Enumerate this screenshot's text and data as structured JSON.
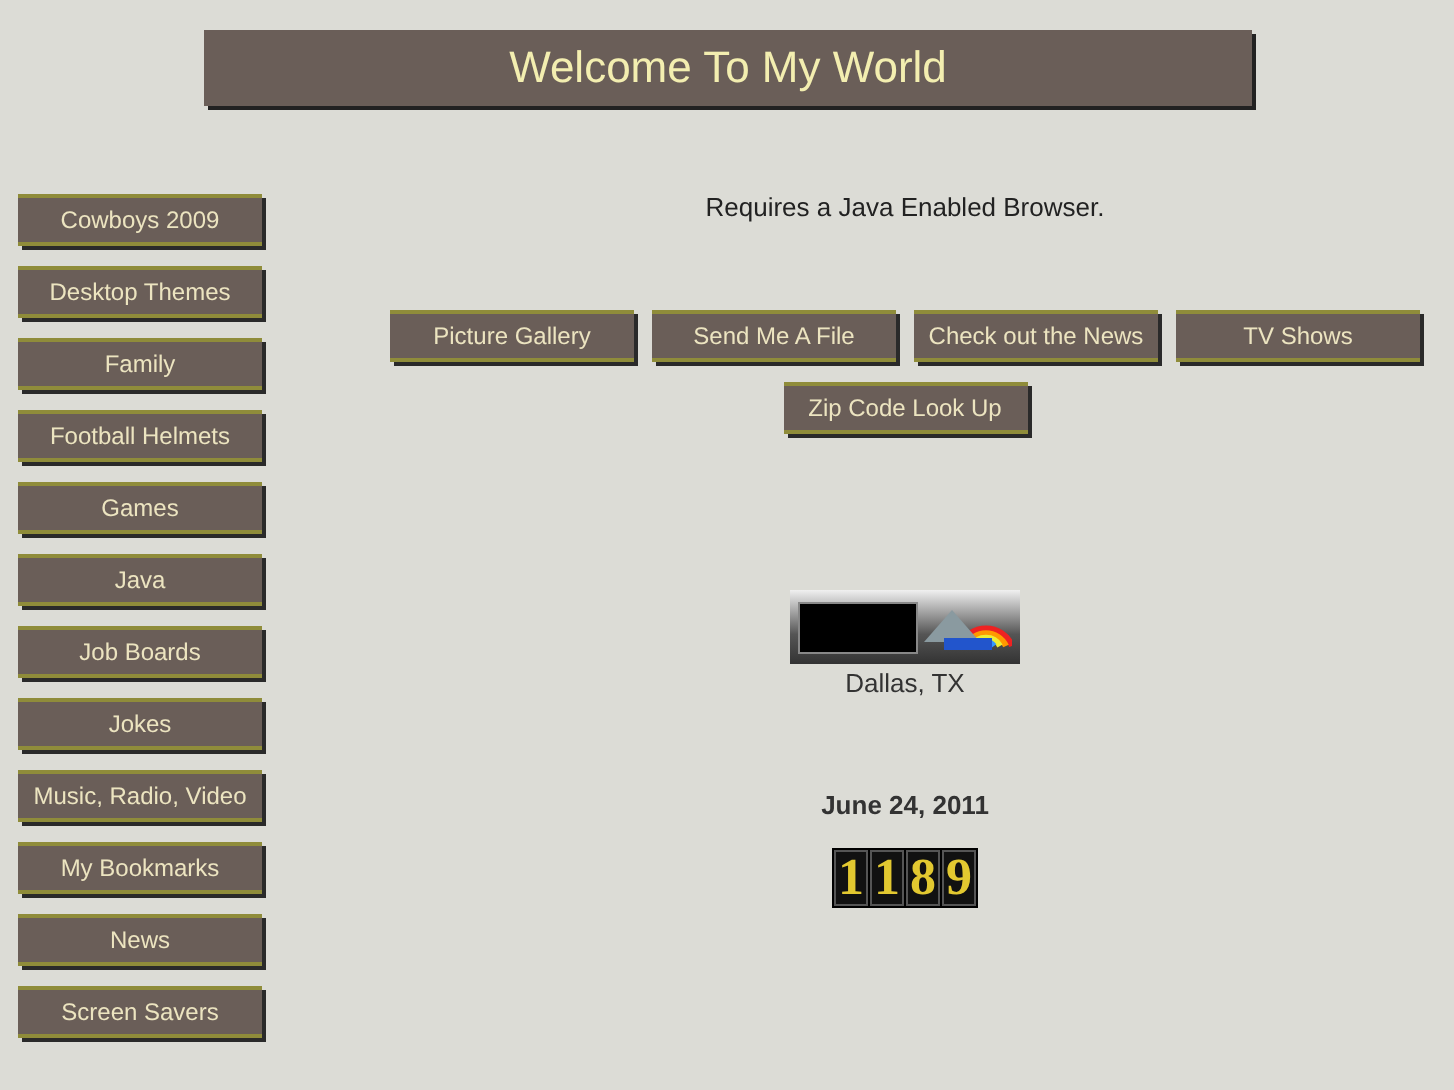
{
  "header": {
    "title": "Welcome To My World"
  },
  "sidebar": {
    "items": [
      {
        "label": "Cowboys 2009"
      },
      {
        "label": "Desktop Themes"
      },
      {
        "label": "Family"
      },
      {
        "label": "Football Helmets"
      },
      {
        "label": "Games"
      },
      {
        "label": "Java"
      },
      {
        "label": "Job Boards"
      },
      {
        "label": "Jokes"
      },
      {
        "label": "Music, Radio, Video"
      },
      {
        "label": "My Bookmarks"
      },
      {
        "label": "News"
      },
      {
        "label": "Screen Savers"
      }
    ]
  },
  "notice": "Requires a Java Enabled Browser.",
  "nav_buttons": [
    {
      "label": "Picture Gallery"
    },
    {
      "label": "Send Me A File"
    },
    {
      "label": "Check out the News"
    },
    {
      "label": "TV Shows"
    },
    {
      "label": "Zip Code Look Up"
    }
  ],
  "weather": {
    "location": "Dallas, TX"
  },
  "date": "June 24, 2011",
  "counter": {
    "digits": [
      "1",
      "1",
      "8",
      "9"
    ]
  }
}
